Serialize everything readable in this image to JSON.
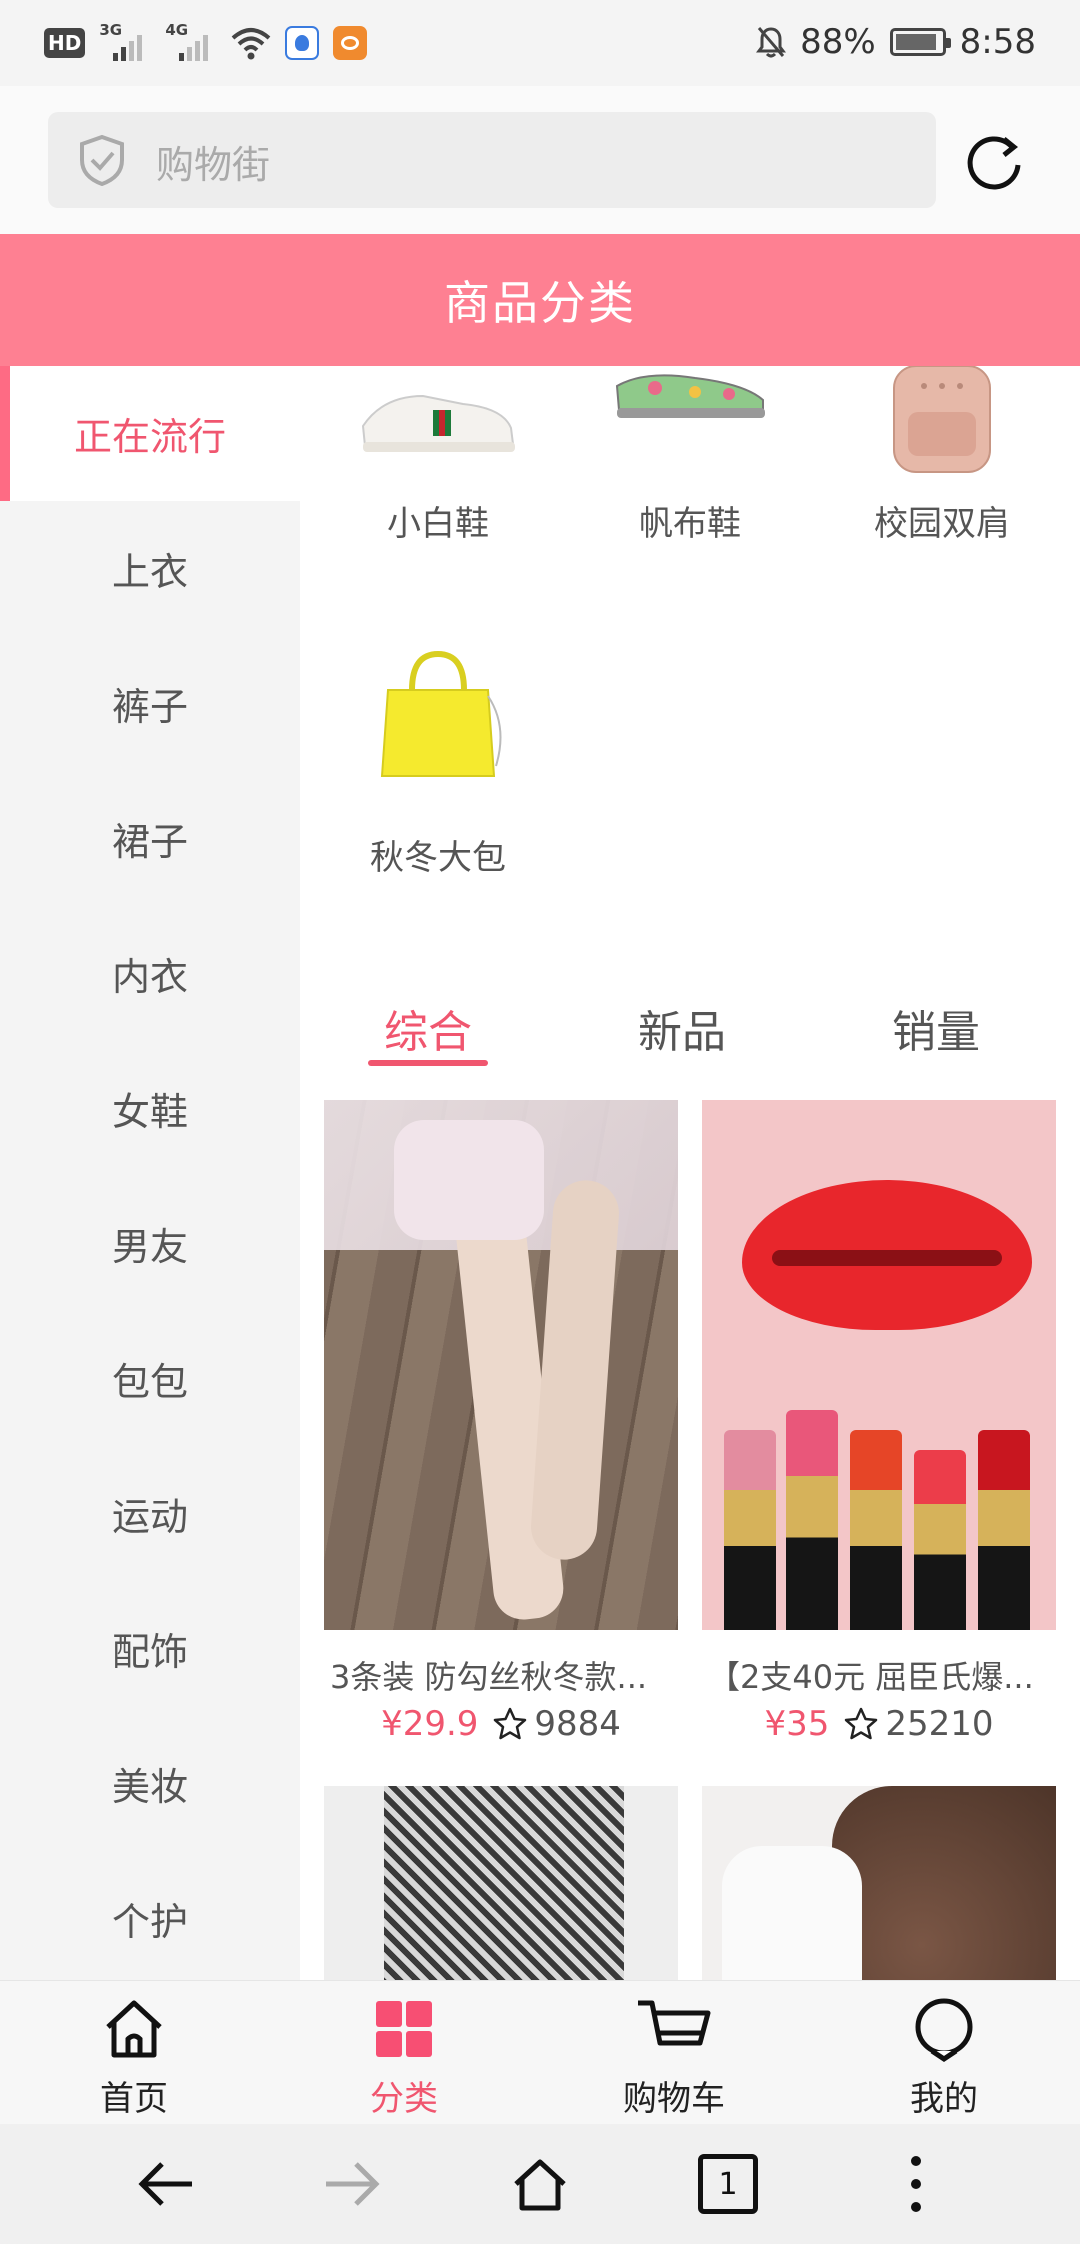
{
  "status": {
    "network": [
      "3G",
      "4G"
    ],
    "hd_label": "HD",
    "battery": "88%",
    "time": "8:58"
  },
  "search": {
    "placeholder": "购物街"
  },
  "header": {
    "title": "商品分类"
  },
  "sidebar": {
    "items": [
      {
        "label": "正在流行",
        "active": true
      },
      {
        "label": "上衣"
      },
      {
        "label": "裤子"
      },
      {
        "label": "裙子"
      },
      {
        "label": "内衣"
      },
      {
        "label": "女鞋"
      },
      {
        "label": "男友"
      },
      {
        "label": "包包"
      },
      {
        "label": "运动"
      },
      {
        "label": "配饰"
      },
      {
        "label": "美妆"
      },
      {
        "label": "个护"
      }
    ]
  },
  "subcategories": [
    {
      "label": "小白鞋",
      "icon": "white-sneaker-image"
    },
    {
      "label": "帆布鞋",
      "icon": "canvas-shoe-image"
    },
    {
      "label": "校园双肩",
      "icon": "backpack-image"
    },
    {
      "label": "秋冬大包",
      "icon": "yellow-handbag-image"
    }
  ],
  "sort_tabs": [
    {
      "label": "综合",
      "active": true
    },
    {
      "label": "新品"
    },
    {
      "label": "销量"
    }
  ],
  "products": [
    {
      "name": "3条装 防勾丝秋冬款...",
      "price": "¥29.9",
      "favorites": "9884",
      "image": "stockings-photo"
    },
    {
      "name": "【2支40元 屈臣氏爆...",
      "price": "¥35",
      "favorites": "25210",
      "image": "lipstick-photo"
    },
    {
      "name": "",
      "price": "",
      "favorites": "",
      "image": "herringbone-pants-photo"
    },
    {
      "name": "",
      "price": "",
      "favorites": "",
      "image": "curly-hair-model-photo"
    }
  ],
  "tabbar": {
    "items": [
      {
        "label": "首页",
        "icon": "home-icon"
      },
      {
        "label": "分类",
        "icon": "category-grid-icon",
        "active": true
      },
      {
        "label": "购物车",
        "icon": "cart-icon"
      },
      {
        "label": "我的",
        "icon": "profile-icon"
      }
    ]
  },
  "browser_nav": {
    "tab_count": "1"
  },
  "colors": {
    "accent": "#f0566f",
    "title_bar": "#fe8092",
    "sidebar_bg": "#f4f4f4"
  }
}
